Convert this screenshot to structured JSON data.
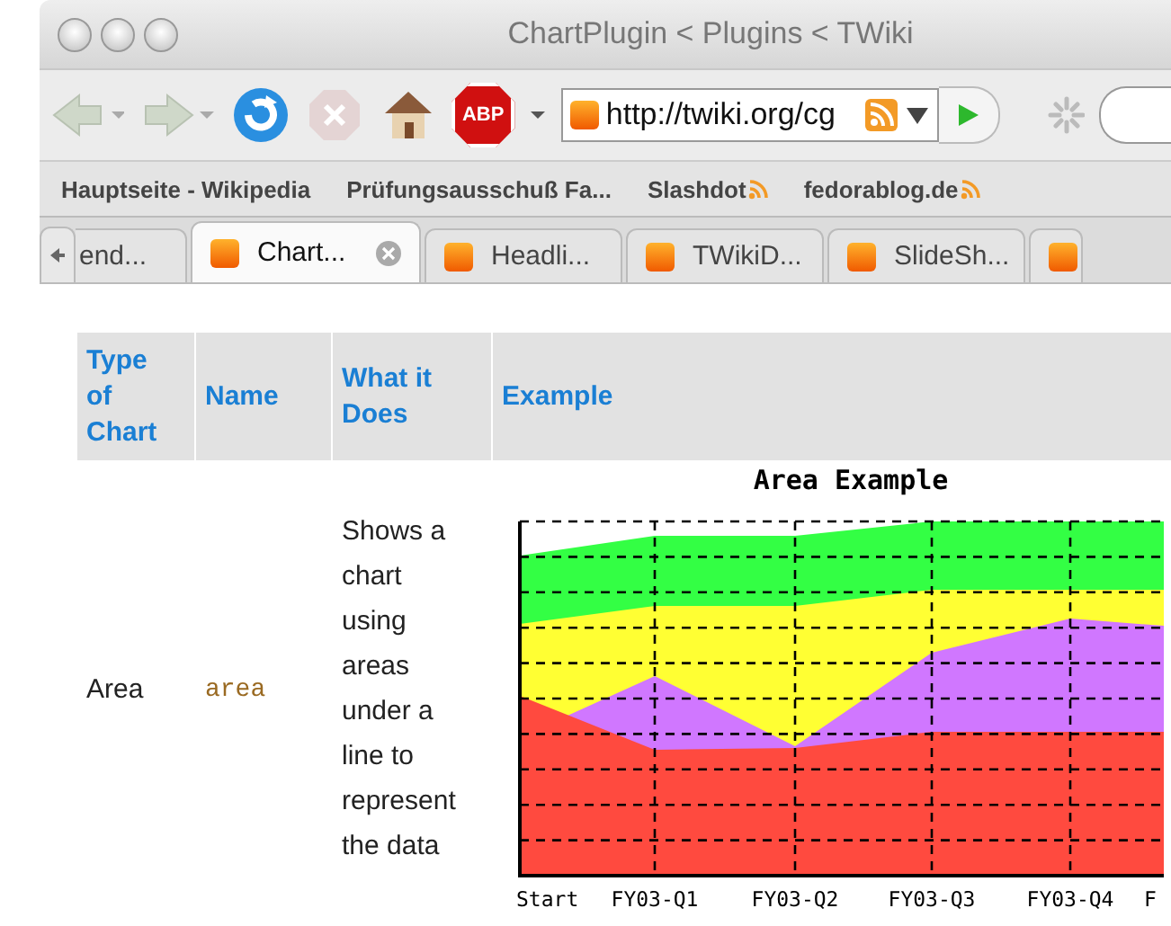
{
  "window": {
    "title": "ChartPlugin < Plugins < TWiki"
  },
  "toolbar": {
    "url": "http://twiki.org/cg",
    "abp_label": "ABP"
  },
  "bookmarks": [
    {
      "label": "Hauptseite - Wikipedia",
      "feed": false
    },
    {
      "label": "Prüfungsausschuß Fa...",
      "feed": false
    },
    {
      "label": "Slashdot",
      "feed": true
    },
    {
      "label": "fedorablog.de",
      "feed": true
    }
  ],
  "tabs": [
    {
      "label": "end...",
      "selected": false,
      "icon": false
    },
    {
      "label": "Chart...",
      "selected": true,
      "icon": true
    },
    {
      "label": "Headli...",
      "selected": false,
      "icon": true
    },
    {
      "label": "TWikiD...",
      "selected": false,
      "icon": true
    },
    {
      "label": "SlideSh...",
      "selected": false,
      "icon": true
    },
    {
      "selected": false,
      "icon": true
    }
  ],
  "table": {
    "columns": [
      "Type of Chart",
      "Name",
      "What it Does",
      "Example"
    ],
    "rows": [
      {
        "type": "Area",
        "name": "area",
        "description": "Shows a chart using areas under a line to represent the data",
        "example": {
          "title": "Area Example",
          "categories": [
            "Start",
            "FY03-Q1",
            "FY03-Q2",
            "FY03-Q3",
            "FY03-Q4",
            "F"
          ]
        }
      }
    ]
  }
}
